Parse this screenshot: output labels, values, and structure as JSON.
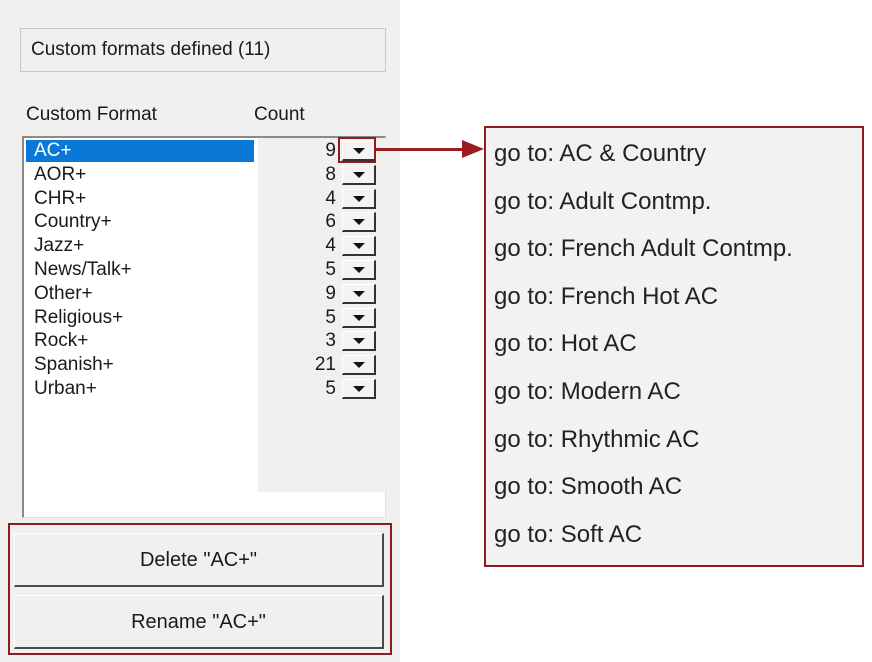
{
  "panel": {
    "header": "Custom formats defined (11)",
    "col_format": "Custom Format",
    "col_count": "Count"
  },
  "formats": [
    {
      "name": "AC+",
      "count": "9",
      "selected": true
    },
    {
      "name": "AOR+",
      "count": "8"
    },
    {
      "name": "CHR+",
      "count": "4"
    },
    {
      "name": "Country+",
      "count": "6"
    },
    {
      "name": "Jazz+",
      "count": "4"
    },
    {
      "name": "News/Talk+",
      "count": "5"
    },
    {
      "name": "Other+",
      "count": "9"
    },
    {
      "name": "Religious+",
      "count": "5"
    },
    {
      "name": "Rock+",
      "count": "3"
    },
    {
      "name": "Spanish+",
      "count": "21"
    },
    {
      "name": "Urban+",
      "count": "5"
    }
  ],
  "menu": [
    "go to: AC & Country",
    "go to: Adult Contmp.",
    "go to: French Adult Contmp.",
    "go to: French Hot AC",
    "go to: Hot AC",
    "go to: Modern AC",
    "go to: Rhythmic AC",
    "go to: Smooth AC",
    "go to: Soft AC"
  ],
  "buttons": {
    "delete": "Delete \"AC+\"",
    "rename": "Rename \"AC+\""
  },
  "icons": {
    "dropdown": "chevron-down-icon",
    "arrow": "arrow-right-icon"
  },
  "colors": {
    "selection": "#0a78d7",
    "callout": "#8c1c20"
  }
}
